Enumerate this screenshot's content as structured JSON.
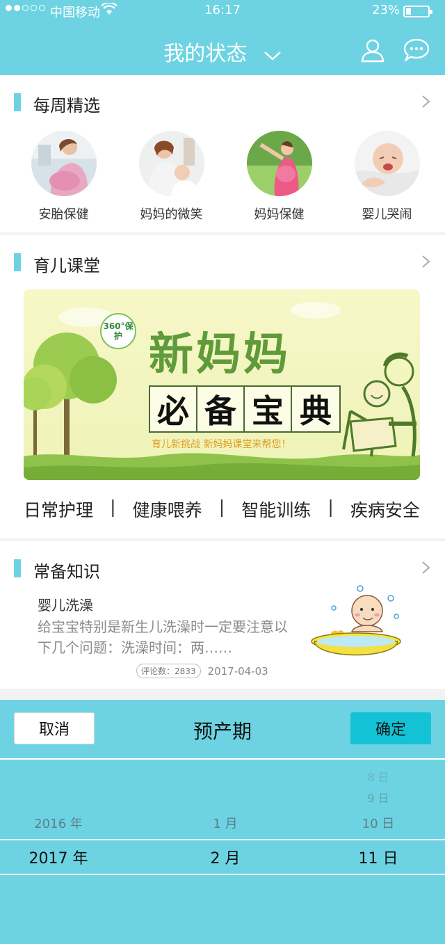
{
  "status_bar": {
    "carrier": "中国移动",
    "time": "16:17",
    "battery": "23%",
    "battery_level": 0.23
  },
  "nav": {
    "title": "我的状态"
  },
  "weekly": {
    "title": "每周精选",
    "items": [
      {
        "label": "安胎保健"
      },
      {
        "label": "妈妈的微笑"
      },
      {
        "label": "妈妈保健"
      },
      {
        "label": "婴儿哭闹"
      }
    ]
  },
  "classroom": {
    "title": "育儿课堂",
    "banner": {
      "badge": "360°保护",
      "title": "新妈妈",
      "chars": [
        "必",
        "备",
        "宝",
        "典"
      ],
      "subtitle": "育儿新挑战 新妈妈课堂来帮您！"
    },
    "categories": [
      "日常护理",
      "健康喂养",
      "智能训练",
      "疾病安全"
    ]
  },
  "knowledge": {
    "title": "常备知识",
    "article": {
      "title": "婴儿洗澡",
      "desc": "给宝宝特别是新生儿洗澡时一定要注意以下几个问题：洗澡时间：两……",
      "comments_label": "评论数：2833",
      "date": "2017-04-03"
    }
  },
  "picker": {
    "cancel": "取消",
    "title": "预产期",
    "confirm": "确定",
    "years": {
      "near": "2016 年",
      "selected": "2017 年"
    },
    "months": {
      "near": "1 月",
      "selected": "2 月"
    },
    "days": {
      "far1": "8 日",
      "far2": "9 日",
      "near": "10 日",
      "selected": "11 日"
    }
  }
}
